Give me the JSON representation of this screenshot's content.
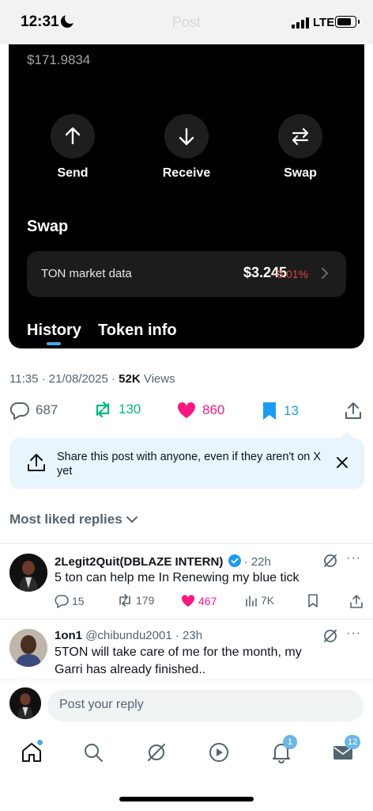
{
  "status_bar": {
    "time": "12:31",
    "title": "Post",
    "network": "LTE"
  },
  "wallet": {
    "usd_value": "$171.9834",
    "actions": [
      {
        "label": "Send",
        "icon": "arrow-up-icon"
      },
      {
        "label": "Receive",
        "icon": "arrow-down-icon"
      },
      {
        "label": "Swap",
        "icon": "swap-arrows-icon"
      }
    ],
    "swap_heading": "Swap",
    "market": {
      "label": "TON market data",
      "price": "$3.245",
      "change": "-0.01%",
      "change_color": "#e0443d"
    },
    "tabs": [
      "History",
      "Token info"
    ]
  },
  "post": {
    "timestamp": "11:35 · 21/08/2025 · ",
    "views_count": "52K",
    "views_label": " Views",
    "replies": "687",
    "reposts": "130",
    "likes": "860",
    "bookmarks": "13"
  },
  "share_banner": {
    "text": "Share this post with anyone, even if they aren't on X yet"
  },
  "replies_section": {
    "title": "Most liked replies"
  },
  "replies": [
    {
      "name": "2Legit2Quit(DBLAZE INTERN)",
      "verified": true,
      "time": "· 22h",
      "text": "5 ton can help me In Renewing my blue tick",
      "replies": "15",
      "reposts": "179",
      "likes": "467",
      "views": "7K"
    },
    {
      "name": "1on1",
      "handle": "@chibundu2001",
      "time": "· 23h",
      "text": "5TON will take care of me for the month, my Garri has already finished.."
    }
  ],
  "composer": {
    "placeholder": "Post your reply"
  },
  "nav": {
    "notifications_badge": "1",
    "messages_badge": "12"
  },
  "colors": {
    "accent": "#1d9bf0",
    "like": "#f91880",
    "repost": "#00ba7c"
  }
}
